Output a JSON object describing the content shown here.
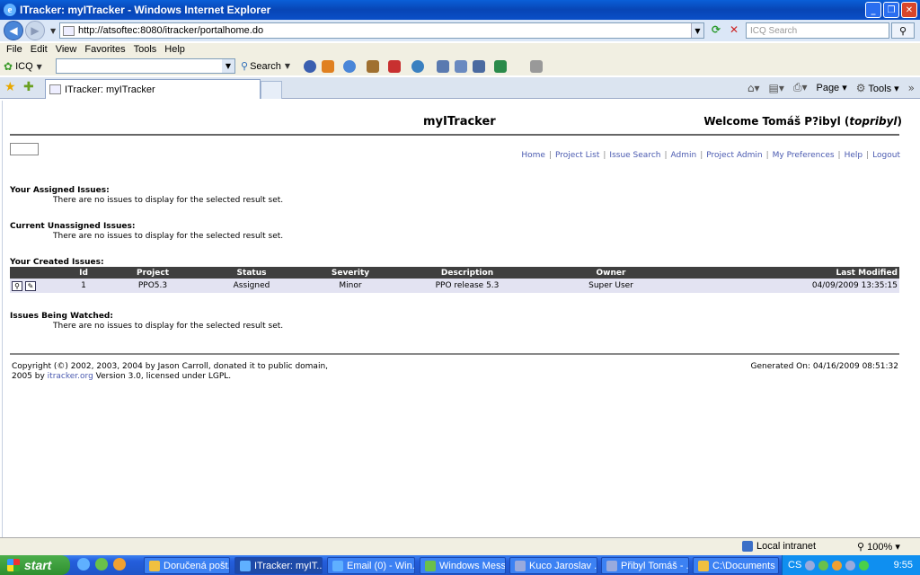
{
  "window": {
    "title": "ITracker: myITracker - Windows Internet Explorer"
  },
  "address": {
    "url": "http://atsoftec:8080/itracker/portalhome.do",
    "search_placeholder": "ICQ Search"
  },
  "menu": [
    "File",
    "Edit",
    "View",
    "Favorites",
    "Tools",
    "Help"
  ],
  "icq": {
    "label": "ICQ",
    "search_label": "Search"
  },
  "tab": {
    "title": "ITracker: myITracker"
  },
  "commandbar": {
    "page_label": "Page",
    "tools_label": "Tools"
  },
  "page": {
    "app_title": "myITracker",
    "welcome_prefix": "Welcome Tomáš P?ibyl (",
    "username": "topribyl",
    "welcome_suffix": ")",
    "nav_links": [
      "Home",
      "Project List",
      "Issue Search",
      "Admin",
      "Project Admin",
      "My Preferences",
      "Help",
      "Logout"
    ],
    "sections": {
      "assigned": {
        "label": "Your Assigned Issues:",
        "message": "There are no issues to display for the selected result set."
      },
      "unassigned": {
        "label": "Current Unassigned Issues:",
        "message": "There are no issues to display for the selected result set."
      },
      "created": {
        "label": "Your Created Issues:"
      },
      "watched": {
        "label": "Issues Being Watched:",
        "message": "There are no issues to display for the selected result set."
      }
    },
    "table": {
      "headers": {
        "id": "Id",
        "project": "Project",
        "status": "Status",
        "severity": "Severity",
        "description": "Description",
        "owner": "Owner",
        "last_modified": "Last Modified"
      },
      "rows": [
        {
          "id": "1",
          "project": "PPO5.3",
          "status": "Assigned",
          "severity": "Minor",
          "description": "PPO release 5.3",
          "owner": "Super User",
          "last_modified": "04/09/2009 13:35:15"
        }
      ]
    },
    "footer": {
      "copyright_line1": "Copyright (©) 2002, 2003, 2004 by Jason Carroll, donated it to public domain,",
      "line2_prefix": "2005 by ",
      "link": "itracker.org",
      "line2_suffix": " Version 3.0, licensed under LGPL.",
      "generated": "Generated On: 04/16/2009 08:51:32"
    }
  },
  "statusbar": {
    "zone": "Local intranet",
    "zoom": "100%"
  },
  "taskbar": {
    "start_label": "start",
    "tasks": [
      "Doručená pošt...",
      "ITracker: myIT...",
      "Email (0) - Win...",
      "Windows Mess...",
      "Kuco Jaroslav ...",
      "Přibyl Tomáš - ...",
      "C:\\Documents ..."
    ],
    "language": "CS",
    "clock": "9:55"
  },
  "colors": {
    "table_header_bg": "#3f3f3f",
    "row_bg": "#e3e3f2",
    "link_color": "#4a5ab0",
    "taskbar_blue": "#245edc",
    "start_green": "#2e8f2e"
  }
}
